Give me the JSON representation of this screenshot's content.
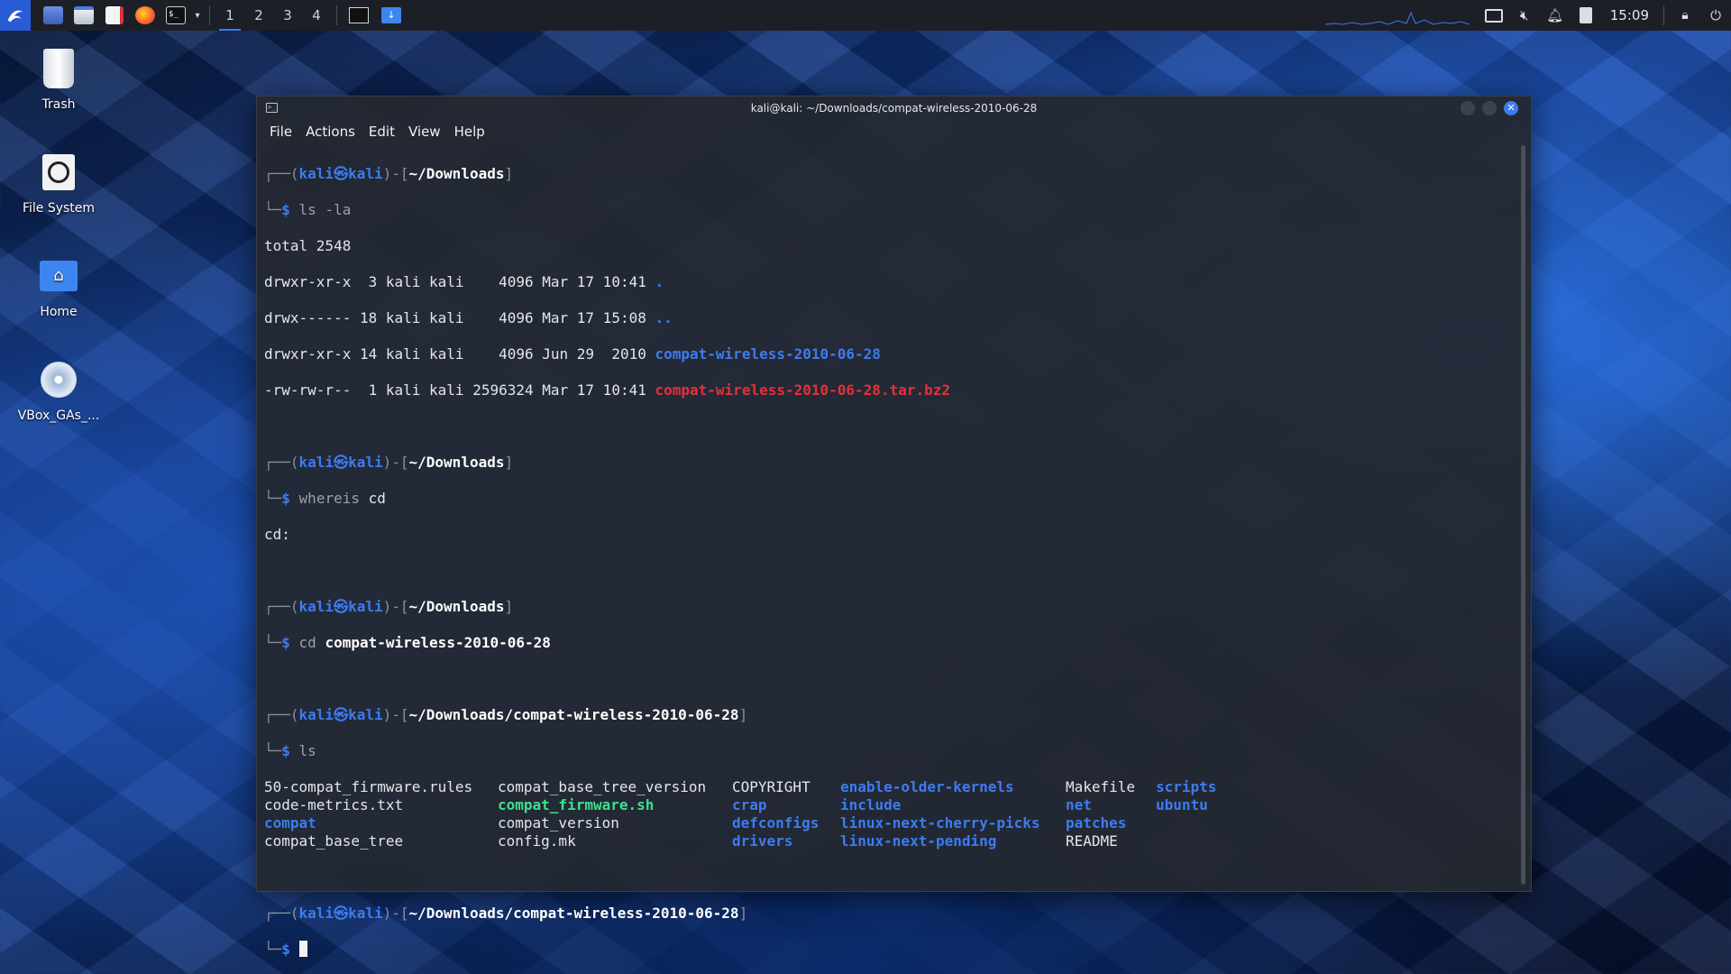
{
  "panel": {
    "workspaces": [
      "1",
      "2",
      "3",
      "4"
    ],
    "clock": "15:09",
    "icons": {
      "app_menu": "kali-menu-icon",
      "desktop": "show-desktop-icon",
      "files": "file-manager-icon",
      "editor": "text-editor-icon",
      "browser": "firefox-icon",
      "terminal": "terminal-icon",
      "tray": [
        "display-icon",
        "volume-muted-icon",
        "bell-icon",
        "battery-icon",
        "lock-icon",
        "power-icon"
      ]
    }
  },
  "desktop": {
    "icons": [
      {
        "label": "Trash",
        "icon": "trash-icon"
      },
      {
        "label": "File System",
        "icon": "drive-icon"
      },
      {
        "label": "Home",
        "icon": "home-folder-icon"
      },
      {
        "label": "VBox_GAs_...",
        "icon": "cdrom-icon"
      }
    ]
  },
  "terminal": {
    "title": "kali@kali: ~/Downloads/compat-wireless-2010-06-28",
    "menu": [
      "File",
      "Actions",
      "Edit",
      "View",
      "Help"
    ],
    "prompt": {
      "user": "kali",
      "at": "㉿",
      "host": "kali",
      "path1": "~/Downloads",
      "path2": "~/Downloads/compat-wireless-2010-06-28",
      "frame_top": "┌──(",
      "frame_mid": ")-[",
      "frame_end": "]",
      "frame_bot": "└─",
      "dollar": "$"
    },
    "cmd1": {
      "name": "ls",
      "args": "-la"
    },
    "ls_la": {
      "total": "total 2548",
      "rows": [
        {
          "meta": "drwxr-xr-x  3 kali kali    4096 Mar 17 10:41 ",
          "name": "."
        },
        {
          "meta": "drwx------ 18 kali kali    4096 Mar 17 15:08 ",
          "name": ".."
        },
        {
          "meta": "drwxr-xr-x 14 kali kali    4096 Jun 29  2010 ",
          "name": "compat-wireless-2010-06-28"
        },
        {
          "meta": "-rw-rw-r--  1 kali kali 2596324 Mar 17 10:41 ",
          "name": "compat-wireless-2010-06-28.tar.bz2"
        }
      ]
    },
    "cmd2": {
      "name": "whereis",
      "args": "cd"
    },
    "whereis_out": "cd:",
    "cmd3": {
      "name": "cd",
      "args": "compat-wireless-2010-06-28"
    },
    "cmd4": {
      "name": "ls",
      "args": ""
    },
    "ls_cols": [
      [
        "50-compat_firmware.rules",
        "code-metrics.txt",
        "compat",
        "compat_base_tree"
      ],
      [
        "compat_base_tree_version",
        "compat_firmware.sh",
        "compat_version",
        "config.mk"
      ],
      [
        "COPYRIGHT",
        "crap",
        "defconfigs",
        "drivers"
      ],
      [
        "enable-older-kernels",
        "include",
        "linux-next-cherry-picks",
        "linux-next-pending"
      ],
      [
        "Makefile",
        "net",
        "patches",
        "README"
      ],
      [
        "scripts",
        "ubuntu",
        "",
        ""
      ]
    ]
  }
}
